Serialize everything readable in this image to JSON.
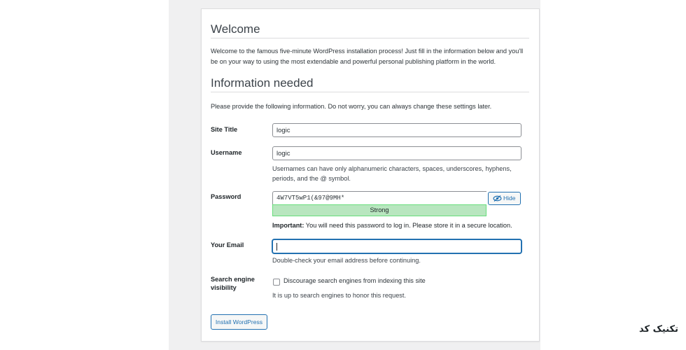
{
  "welcome": {
    "title": "Welcome",
    "intro": "Welcome to the famous five-minute WordPress installation process! Just fill in the information below and you'll be on your way to using the most extendable and powerful personal publishing platform in the world."
  },
  "info": {
    "title": "Information needed",
    "description": "Please provide the following information. Do not worry, you can always change these settings later."
  },
  "form": {
    "site_title": {
      "label": "Site Title",
      "value": "logic"
    },
    "username": {
      "label": "Username",
      "value": "logic",
      "help": "Usernames can have only alphanumeric characters, spaces, underscores, hyphens, periods, and the @ symbol."
    },
    "password": {
      "label": "Password",
      "value": "4W7VT5wP1(&97@9MH*",
      "strength": "Strong",
      "hide_label": "Hide",
      "important_prefix": "Important:",
      "important_text": " You will need this password to log in. Please store it in a secure location."
    },
    "email": {
      "label": "Your Email",
      "value": "",
      "help": "Double-check your email address before continuing."
    },
    "search_visibility": {
      "label": "Search engine visibility",
      "checkbox_label": "Discourage search engines from indexing this site",
      "checked": false,
      "help": "It is up to search engines to honor this request."
    },
    "submit_label": "Install WordPress"
  },
  "icons": {
    "hide": "eye-slash-icon"
  },
  "colors": {
    "accent": "#2271b1",
    "strength_bg": "#b8e6bf",
    "strength_border": "#68de7c"
  },
  "watermark": "تکنیک کد"
}
